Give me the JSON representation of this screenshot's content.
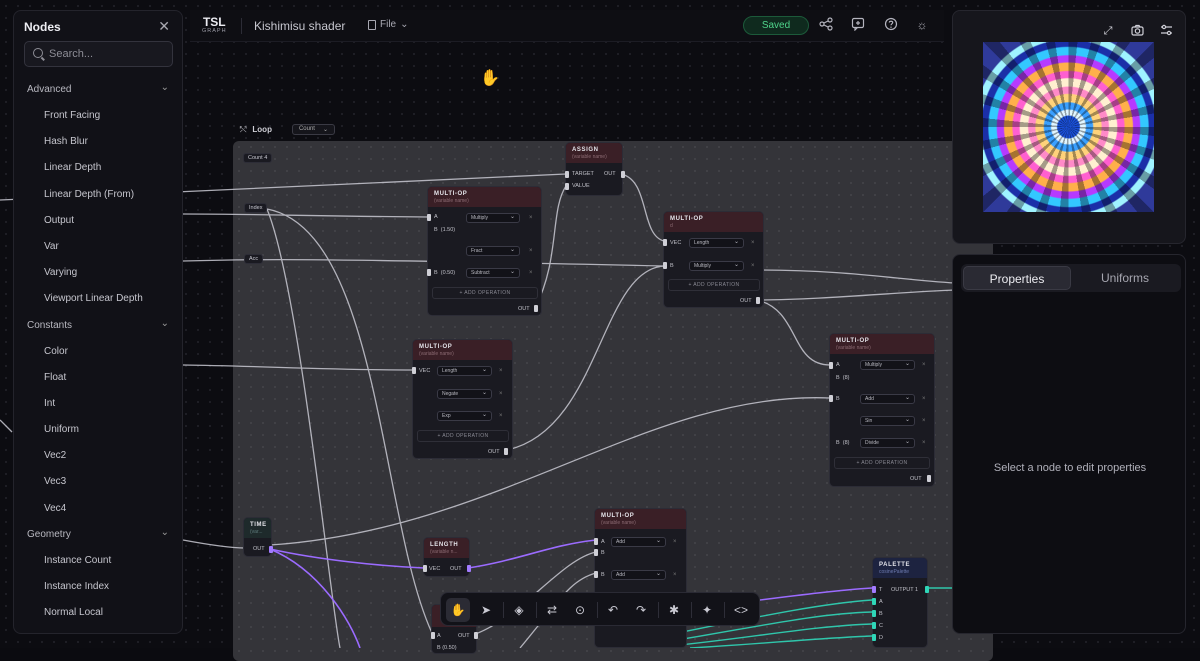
{
  "sidebar": {
    "title": "Nodes",
    "search_placeholder": "Search...",
    "categories": [
      {
        "name": "Advanced",
        "items": [
          "Front Facing",
          "Hash Blur",
          "Linear Depth",
          "Linear Depth (From)",
          "Output",
          "Var",
          "Varying",
          "Viewport Linear Depth"
        ]
      },
      {
        "name": "Constants",
        "items": [
          "Color",
          "Float",
          "Int",
          "Uniform",
          "Vec2",
          "Vec3",
          "Vec4"
        ]
      },
      {
        "name": "Geometry",
        "items": [
          "Instance Count",
          "Instance Index",
          "Normal Local"
        ]
      }
    ]
  },
  "topbar": {
    "logo_main": "TSL",
    "logo_sub": "GRAPH",
    "title": "Kishimisu shader",
    "file_menu": "File",
    "status": "Saved"
  },
  "loop": {
    "label": "Loop",
    "mode": "Count",
    "count_label": "Count",
    "count_value": "4",
    "index_label": "Index",
    "acc_label": "Acc"
  },
  "nodes": {
    "assign": {
      "title": "ASSIGN",
      "sub": "(variable name)",
      "target": "TARGET",
      "value": "VALUE",
      "out": "OUT"
    },
    "multiop1": {
      "title": "MULTI-OP",
      "sub": "(variable name)",
      "a": "A",
      "b1": "B",
      "b1v": "(1.50)",
      "op1": "Multiply",
      "op2": "Fract",
      "b2": "B",
      "b2v": "(0.50)",
      "op3": "Subtract",
      "add": "+ ADD OPERATION",
      "out": "OUT"
    },
    "multiop2": {
      "title": "MULTI-OP",
      "sub": "d",
      "vec": "VEC",
      "op1": "Length",
      "b": "B",
      "op2": "Multiply",
      "add": "+ ADD OPERATION",
      "out": "OUT"
    },
    "multiop3": {
      "title": "MULTI-OP",
      "sub": "(variable name)",
      "vec": "VEC",
      "op1": "Length",
      "op2": "Negate",
      "op3": "Exp",
      "add": "+ ADD OPERATION",
      "out": "OUT"
    },
    "multiop4": {
      "title": "MULTI-OP",
      "sub": "(variable name)",
      "a": "A",
      "b1": "B",
      "b1v": "(8)",
      "op1": "Multiply",
      "b2": "B",
      "op2": "Add",
      "op3": "Sin",
      "b3": "B",
      "b3v": "(8)",
      "op4": "Divide",
      "add": "+ ADD OPERATION",
      "out": "OUT"
    },
    "time": {
      "title": "TIME",
      "sub": "(var...",
      "out": "OUT"
    },
    "length": {
      "title": "LENGTH",
      "sub": "(variable n...",
      "vec": "VEC",
      "out": "OUT"
    },
    "multiop5": {
      "title": "MULTI-OP",
      "sub": "(variable name)",
      "a": "A",
      "b": "B",
      "op1": "Add",
      "b2": "B",
      "op2": "Add"
    },
    "palette": {
      "title": "PALETTE",
      "sub": "cosinePalette",
      "t": "T",
      "out": "OUTPUT 1",
      "a": "A",
      "b": "B",
      "c": "C",
      "d": "D"
    },
    "partial": {
      "a": "A",
      "out": "OUT",
      "b": "B",
      "bv": "(0.50)"
    }
  },
  "properties": {
    "tab_properties": "Properties",
    "tab_uniforms": "Uniforms",
    "empty_message": "Select a node to edit properties"
  },
  "icons": {
    "close": "close-icon",
    "search": "search-icon",
    "share": "share-icon",
    "comment": "comment-plus-icon",
    "help": "help-icon",
    "theme": "sun-icon",
    "expand": "expand-icon",
    "camera": "camera-icon",
    "settings": "sliders-icon"
  },
  "colors": {
    "accent_green": "#4fd48b",
    "wire_purple": "#9b6bff",
    "wire_teal": "#2fd6b8",
    "node_header": "#3a1f26"
  }
}
